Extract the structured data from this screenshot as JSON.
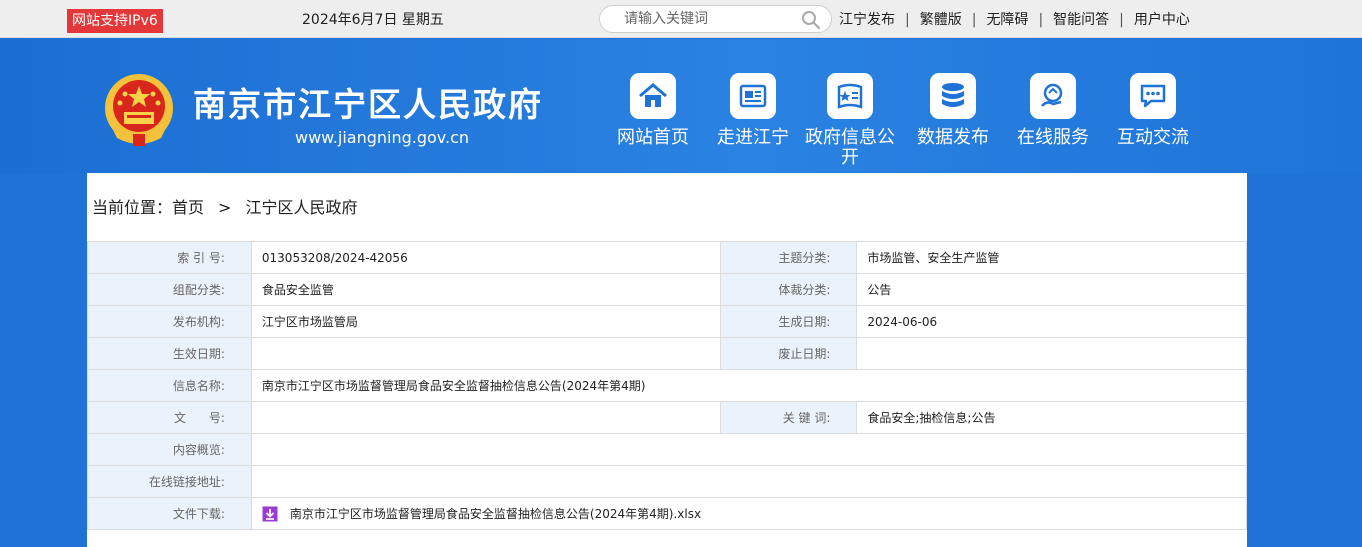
{
  "topbar": {
    "ipv6_badge": "网站支持IPv6",
    "date": "2024年6月7日 星期五",
    "search_placeholder": "请输入关键词",
    "links": [
      "江宁发布",
      "繁體版",
      "无障碍",
      "智能问答",
      "用户中心"
    ],
    "separator": "|"
  },
  "header": {
    "title": "南京市江宁区人民政府",
    "url": "www.jiangning.gov.cn",
    "nav": [
      {
        "label": "网站首页",
        "icon": "home-icon"
      },
      {
        "label": "走进江宁",
        "icon": "newspaper-icon"
      },
      {
        "label": "政府信息公开",
        "icon": "document-icon"
      },
      {
        "label": "数据发布",
        "icon": "database-icon"
      },
      {
        "label": "在线服务",
        "icon": "hand-service-icon"
      },
      {
        "label": "互动交流",
        "icon": "chat-icon"
      }
    ]
  },
  "breadcrumb": {
    "prefix": "当前位置：",
    "home": "首页",
    "arrow": ">",
    "current": "江宁区人民政府"
  },
  "meta": {
    "index_label": "索 引 号:",
    "index_value": "013053208/2024-42056",
    "topic_label": "主题分类:",
    "topic_value": "市场监管、安全生产监管",
    "group_label": "组配分类:",
    "group_value": "食品安全监管",
    "genre_label": "体裁分类:",
    "genre_value": "公告",
    "issuer_label": "发布机构:",
    "issuer_value": "江宁区市场监管局",
    "created_label": "生成日期:",
    "created_value": "2024-06-06",
    "effective_label": "生效日期:",
    "effective_value": "",
    "abolished_label": "废止日期:",
    "abolished_value": "",
    "name_label": "信息名称:",
    "name_value": "南京市江宁区市场监督管理局食品安全监督抽检信息公告(2024年第4期)",
    "docno_label": "文      号:",
    "docno_value": "",
    "keywords_label": "关 键 词:",
    "keywords_value": "食品安全;抽检信息;公告",
    "summary_label": "内容概览:",
    "summary_value": "",
    "link_label": "在线链接地址:",
    "link_value": "",
    "download_label": "文件下载:",
    "download_value": "南京市江宁区市场监督管理局食品安全监督抽检信息公告(2024年第4期).xlsx"
  },
  "colors": {
    "header_blue": "#1f73d6",
    "ipv6_red": "#e3373a",
    "label_bg": "#eaf2fb",
    "download_purple": "#9b3bd6"
  }
}
